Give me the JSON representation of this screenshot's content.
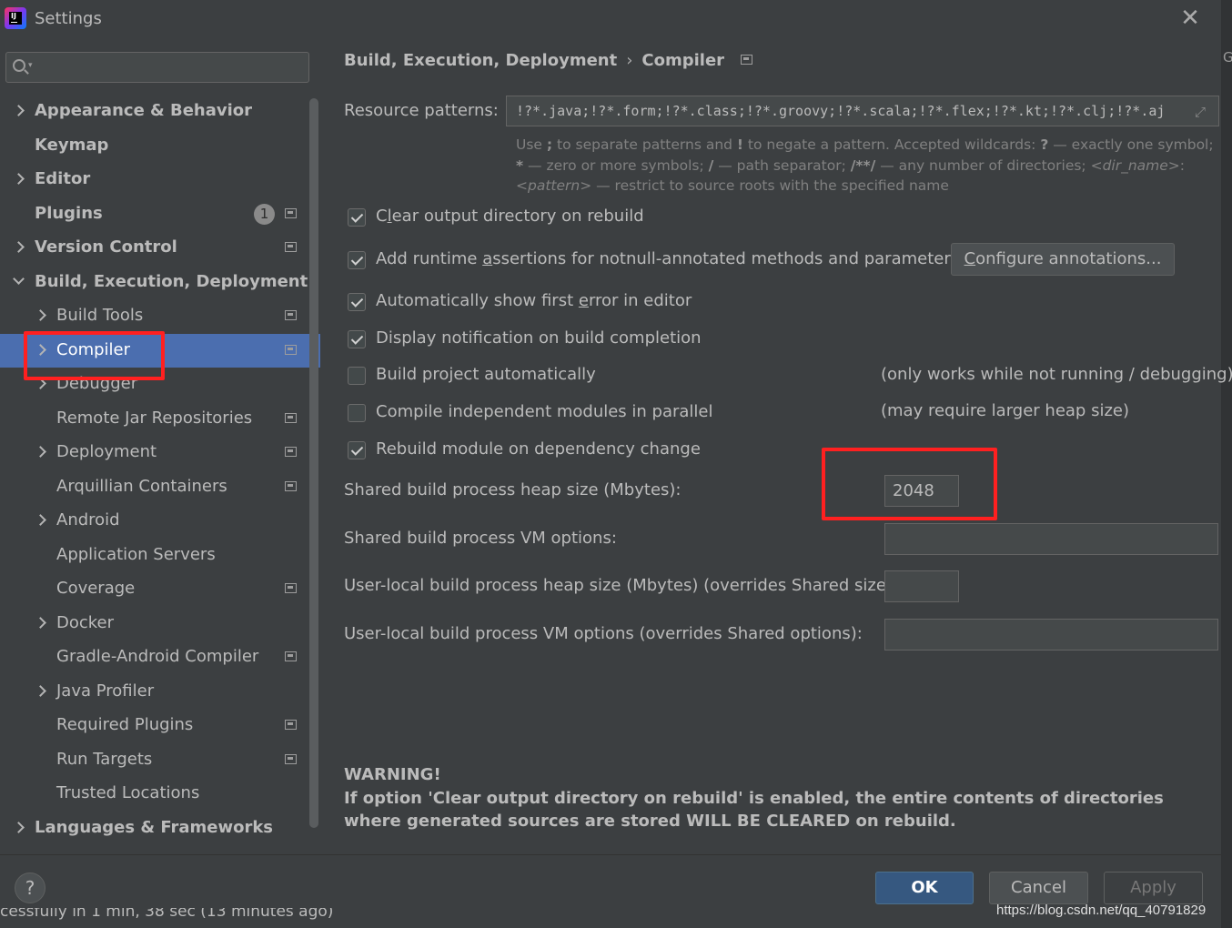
{
  "window": {
    "title": "Settings"
  },
  "sidebar": {
    "search": {
      "placeholder": "",
      "value": ""
    },
    "items": [
      {
        "label": "Appearance & Behavior",
        "level": 0,
        "expander": "right",
        "bold": true,
        "projIcon": false
      },
      {
        "label": "Keymap",
        "level": 0,
        "expander": "none",
        "bold": true,
        "projIcon": false
      },
      {
        "label": "Editor",
        "level": 0,
        "expander": "right",
        "bold": true,
        "projIcon": false
      },
      {
        "label": "Plugins",
        "level": 0,
        "expander": "none",
        "bold": true,
        "projIcon": true,
        "badge": "1"
      },
      {
        "label": "Version Control",
        "level": 0,
        "expander": "right",
        "bold": true,
        "projIcon": true
      },
      {
        "label": "Build, Execution, Deployment",
        "level": 0,
        "expander": "down",
        "bold": true,
        "projIcon": false
      },
      {
        "label": "Build Tools",
        "level": 1,
        "expander": "right",
        "bold": false,
        "projIcon": true
      },
      {
        "label": "Compiler",
        "level": 1,
        "expander": "right",
        "bold": false,
        "projIcon": true,
        "selected": true
      },
      {
        "label": "Debugger",
        "level": 1,
        "expander": "right",
        "bold": false,
        "projIcon": false
      },
      {
        "label": "Remote Jar Repositories",
        "level": 1,
        "expander": "none",
        "bold": false,
        "projIcon": true
      },
      {
        "label": "Deployment",
        "level": 1,
        "expander": "right",
        "bold": false,
        "projIcon": true
      },
      {
        "label": "Arquillian Containers",
        "level": 1,
        "expander": "none",
        "bold": false,
        "projIcon": true
      },
      {
        "label": "Android",
        "level": 1,
        "expander": "right",
        "bold": false,
        "projIcon": false
      },
      {
        "label": "Application Servers",
        "level": 1,
        "expander": "none",
        "bold": false,
        "projIcon": false
      },
      {
        "label": "Coverage",
        "level": 1,
        "expander": "none",
        "bold": false,
        "projIcon": true
      },
      {
        "label": "Docker",
        "level": 1,
        "expander": "right",
        "bold": false,
        "projIcon": false
      },
      {
        "label": "Gradle-Android Compiler",
        "level": 1,
        "expander": "none",
        "bold": false,
        "projIcon": true
      },
      {
        "label": "Java Profiler",
        "level": 1,
        "expander": "right",
        "bold": false,
        "projIcon": false
      },
      {
        "label": "Required Plugins",
        "level": 1,
        "expander": "none",
        "bold": false,
        "projIcon": true
      },
      {
        "label": "Run Targets",
        "level": 1,
        "expander": "none",
        "bold": false,
        "projIcon": true
      },
      {
        "label": "Trusted Locations",
        "level": 1,
        "expander": "none",
        "bold": false,
        "projIcon": false
      },
      {
        "label": "Languages & Frameworks",
        "level": 0,
        "expander": "right",
        "bold": true,
        "projIcon": false
      }
    ]
  },
  "main": {
    "breadcrumb": {
      "parent": "Build, Execution, Deployment",
      "separator": "›",
      "current": "Compiler"
    },
    "resource_patterns": {
      "label": "Resource patterns:",
      "value": "!?*.java;!?*.form;!?*.class;!?*.groovy;!?*.scala;!?*.flex;!?*.kt;!?*.clj;!?*.aj"
    },
    "hint": {
      "p1": "Use ",
      "b1": ";",
      "p2": " to separate patterns and ",
      "b2": "!",
      "p3": " to negate a pattern. Accepted wildcards: ",
      "b3": "?",
      "p4": " — exactly one symbol; ",
      "b4": "*",
      "p5": " — zero or more symbols; ",
      "b5": "/",
      "p6": " — path separator; ",
      "b6": "/**/",
      "p7": " — any number of directories; ",
      "i1": "<dir_name>",
      "p8": ": ",
      "i2": "<pattern>",
      "p9": " — restrict to source roots with the specified name"
    },
    "options": {
      "clear_output": {
        "pre": "C",
        "mn": "l",
        "post": "ear output directory on rebuild",
        "checked": true
      },
      "runtime_assertions": {
        "pre": "Add runtime ",
        "mn": "a",
        "post": "ssertions for notnull-annotated methods and parameters",
        "checked": true
      },
      "configure_annotations": {
        "pre": "",
        "mn": "C",
        "post": "onfigure annotations..."
      },
      "show_first_error": {
        "pre": "Automatically show first ",
        "mn": "e",
        "post": "rror in editor",
        "checked": true
      },
      "display_notification": {
        "pre": "",
        "mn": "",
        "post": "Display notification on build completion",
        "checked": true
      },
      "build_auto": {
        "label": "Build project automatically",
        "checked": false,
        "note": "(only works while not running / debugging)"
      },
      "compile_parallel": {
        "label": "Compile independent modules in parallel",
        "checked": false,
        "note": "(may require larger heap size)"
      },
      "rebuild_on_dep": {
        "label": "Rebuild module on dependency change",
        "checked": true
      }
    },
    "fields": {
      "heap_size": {
        "label": "Shared build process heap size (Mbytes):",
        "value": "2048"
      },
      "vm_options": {
        "label": "Shared build process VM options:",
        "value": ""
      },
      "user_heap": {
        "label": "User-local build process heap size (Mbytes) (overrides Shared size):",
        "value": ""
      },
      "user_vm": {
        "label": "User-local build process VM options (overrides Shared options):",
        "value": ""
      }
    },
    "warning": {
      "title": "WARNING!",
      "body": "If option 'Clear output directory on rebuild' is enabled, the entire contents of directories where generated sources are stored WILL BE CLEARED on rebuild."
    }
  },
  "footer": {
    "help": "?",
    "ok": "OK",
    "cancel": "Cancel",
    "apply": "Apply",
    "status_fragment": "cessfully in 1 min, 38 sec (13 minutes ago)",
    "watermark": "https://blog.csdn.net/qq_40791829"
  },
  "colors": {
    "selection": "#4b6eaf",
    "highlight": "#ff2020",
    "ok_button": "#365880"
  },
  "icons": {
    "app": "intellij-logo-icon",
    "close": "close-icon",
    "search": "search-icon",
    "project": "project-level-icon",
    "expand": "expand-icon",
    "chevron_right": "chevron-right-icon",
    "chevron_down": "chevron-down-icon"
  }
}
